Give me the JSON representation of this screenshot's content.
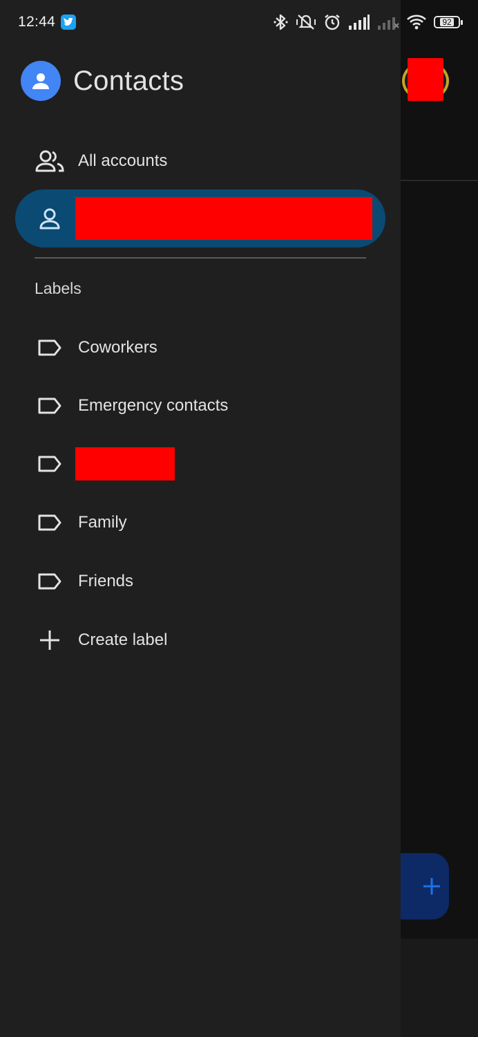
{
  "status_bar": {
    "time": "12:44",
    "battery": "92"
  },
  "drawer": {
    "app_title": "Contacts",
    "accounts": {
      "all_accounts": "All accounts"
    },
    "labels_heading": "Labels",
    "labels": [
      {
        "label": "Coworkers"
      },
      {
        "label": "Emergency contacts"
      },
      {
        "label": "Family"
      },
      {
        "label": "Friends"
      }
    ],
    "create_label": "Create label"
  },
  "colors": {
    "drawer_bg": "#1f1f20",
    "active_item_bg": "#0a4a73",
    "accent_blue": "#4285f4",
    "fab_bg": "#0d2a66",
    "redaction": "#ff0000"
  },
  "icons": {
    "all_accounts": "people-icon",
    "account": "person-icon",
    "label": "label-outline-icon",
    "create": "plus-icon"
  }
}
